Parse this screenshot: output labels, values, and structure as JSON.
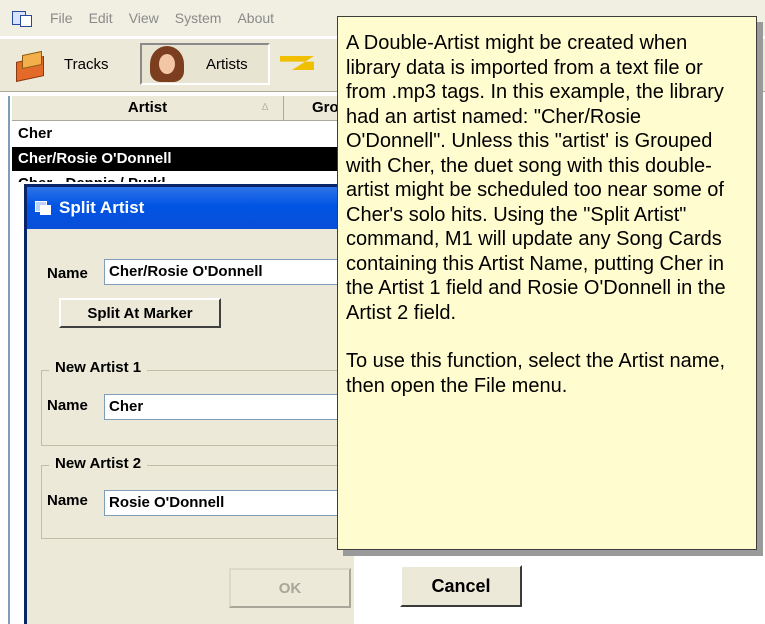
{
  "menu": [
    "File",
    "Edit",
    "View",
    "System",
    "About"
  ],
  "toolbar": {
    "tracks_label": "Tracks",
    "artists_label": "Artists"
  },
  "grid": {
    "col_artist": "Artist",
    "col_group": "Gro",
    "sort_glyph": "∆",
    "rows": [
      "Cher",
      "Cher/Rosie O'Donnell",
      "Cher - Dennis / Purkl..."
    ]
  },
  "dialog": {
    "title": "Split Artist",
    "name_label": "Name",
    "name_value": "Cher/Rosie O'Donnell",
    "split_button": "Split At Marker",
    "group1_label": "New Artist 1",
    "group1_name_label": "Name",
    "group1_value": "Cher",
    "group2_label": "New Artist 2",
    "group2_name_label": "Name",
    "group2_value": "Rosie O'Donnell",
    "ok_label": "OK",
    "cancel_label": "Cancel"
  },
  "tooltip": {
    "paragraph1": "A Double-Artist might be created when library data is imported from a text file or from .mp3 tags.  In this example, the library had an artist named: \"Cher/Rosie O'Donnell\". Unless this \"artist' is Grouped with Cher, the duet song with this double-artist might be scheduled too near some of Cher's solo hits.  Using the \"Split Artist\" command, M1 will update any Song Cards containing this Artist Name, putting Cher in the Artist 1 field and Rosie O'Donnell in the Artist 2 field.",
    "paragraph2": "To use this function, select the Artist name, then open the File menu."
  },
  "colors": {
    "title_bar": "#0054e3",
    "tooltip_bg": "#fffccf",
    "selected_row": "#000000",
    "dialog_bg": "#ece9d8"
  }
}
